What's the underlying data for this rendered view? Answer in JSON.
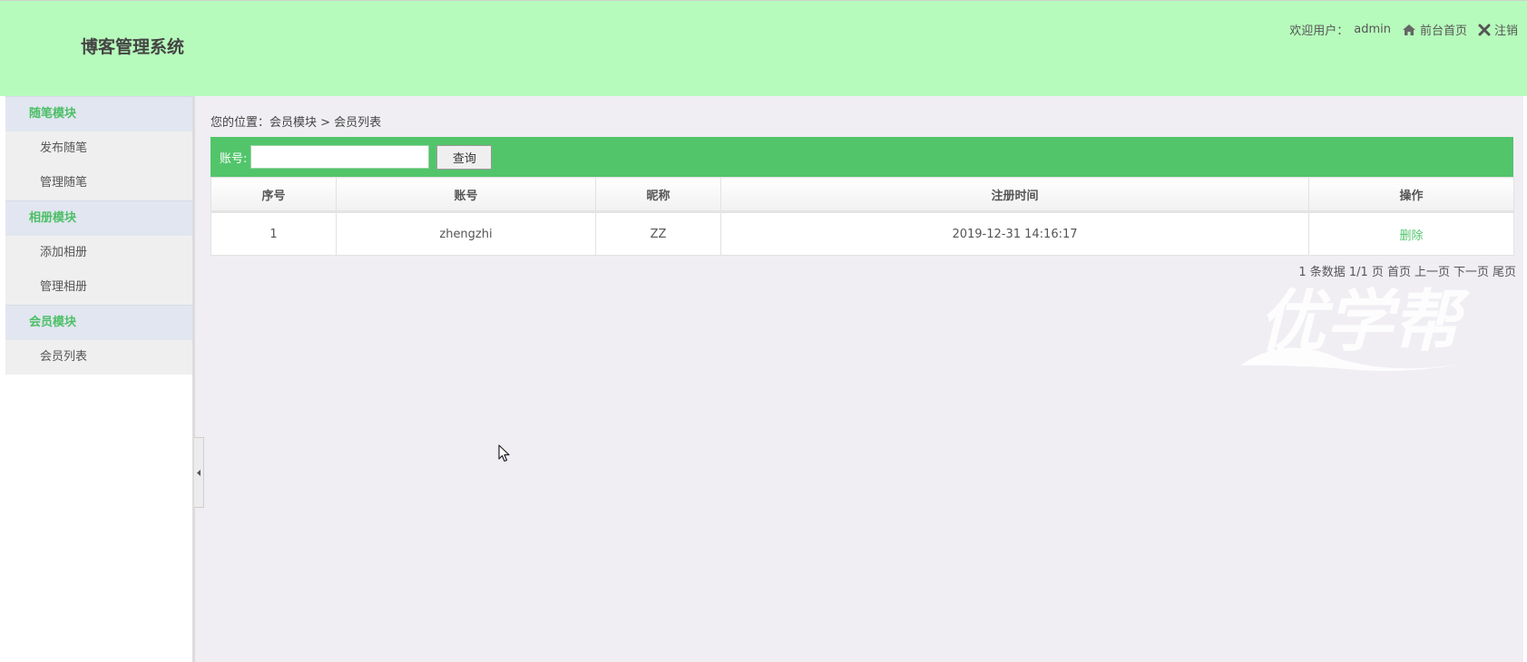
{
  "header": {
    "title": "博客管理系统",
    "welcome_label": "欢迎用户：",
    "username": "admin",
    "home_link": "前台首页",
    "logout_link": "注销"
  },
  "sidebar": {
    "sections": [
      {
        "title": "随笔模块",
        "items": [
          "发布随笔",
          "管理随笔"
        ]
      },
      {
        "title": "相册模块",
        "items": [
          "添加相册",
          "管理相册"
        ]
      },
      {
        "title": "会员模块",
        "items": [
          "会员列表"
        ]
      }
    ]
  },
  "main": {
    "breadcrumb": "您的位置：会员模块 > 会员列表",
    "search": {
      "label": "账号:",
      "value": "",
      "placeholder": "",
      "button": "查询"
    },
    "table": {
      "headers": [
        "序号",
        "账号",
        "昵称",
        "注册时间",
        "操作"
      ],
      "rows": [
        {
          "index": "1",
          "account": "zhengzhi",
          "nickname": "ZZ",
          "registered": "2019-12-31 14:16:17",
          "action": "删除"
        }
      ]
    },
    "pagination": {
      "summary": "1 条数据 1/1 页",
      "first": "首页",
      "prev": "上一页",
      "next": "下一页",
      "last": "尾页"
    }
  },
  "colors": {
    "header_bg": "#b7fbbc",
    "accent_green": "#52c56b",
    "sidebar_section_bg": "#e1e6f0",
    "content_bg": "#f0eef3"
  },
  "icons": [
    "home-icon",
    "close-icon",
    "collapse-arrow-icon",
    "mouse-cursor-icon"
  ],
  "watermark": "优学帮"
}
